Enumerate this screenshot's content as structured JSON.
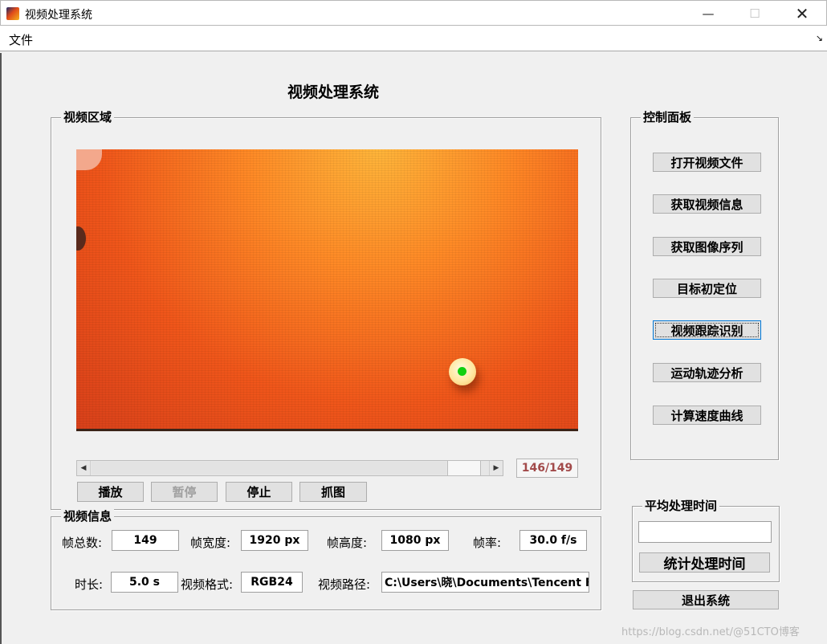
{
  "window": {
    "title": "视频处理系统",
    "minimize": "—",
    "maximize": "☐",
    "close": "✕"
  },
  "menu": {
    "file": "文件",
    "toolbar_toggle": "↘"
  },
  "app_title": "视频处理系统",
  "video_area": {
    "label": "视频区域",
    "frame_counter": "146/149",
    "slider_left": "◀",
    "slider_right": "▶",
    "slider_position": 0.98,
    "buttons": {
      "play": "播放",
      "pause": "暂停",
      "stop": "停止",
      "grab": "抓图"
    }
  },
  "control_panel": {
    "label": "控制面板",
    "buttons": [
      "打开视频文件",
      "获取视频信息",
      "获取图像序列",
      "目标初定位",
      "视频跟踪识别",
      "运动轨迹分析",
      "计算速度曲线"
    ]
  },
  "video_info": {
    "label": "视频信息",
    "total_frames_label": "帧总数:",
    "total_frames": "149",
    "width_label": "帧宽度:",
    "width": "1920 px",
    "height_label": "帧高度:",
    "height": "1080 px",
    "fps_label": "帧率:",
    "fps": "30.0 f/s",
    "duration_label": "时长:",
    "duration": "5.0 s",
    "format_label": "视频格式:",
    "format": "RGB24",
    "path_label": "视频路径:",
    "path": "C:\\Users\\晓\\Documents\\Tencent File"
  },
  "avg_time": {
    "label": "平均处理时间",
    "value": "",
    "stat_button": "统计处理时间"
  },
  "exit_button": "退出系统",
  "watermark": "https://blog.csdn.net/@51CTO博客",
  "colors": {
    "frame_counter_text": "#a24a4a",
    "tracking_dot": "#10d010"
  }
}
